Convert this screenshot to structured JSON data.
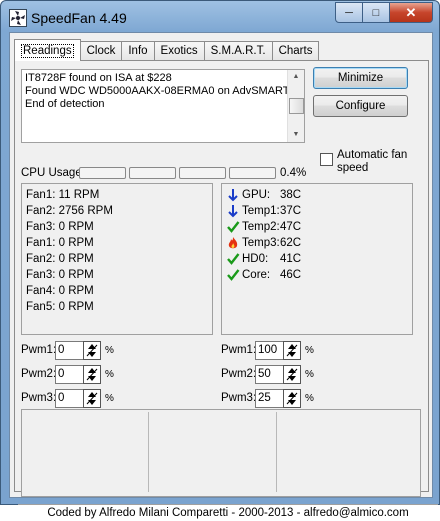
{
  "window": {
    "title": "SpeedFan 4.49",
    "controls": [
      "minimize",
      "maximize",
      "close"
    ]
  },
  "tabs": [
    {
      "label": "Readings",
      "active": true
    },
    {
      "label": "Clock"
    },
    {
      "label": "Info"
    },
    {
      "label": "Exotics"
    },
    {
      "label": "S.M.A.R.T."
    },
    {
      "label": "Charts"
    }
  ],
  "log": {
    "lines": [
      "IT8728F found on ISA at $228",
      "Found WDC WD5000AAKX-08ERMA0 on AdvSMART",
      "End of detection"
    ]
  },
  "buttons": {
    "minimize": "Minimize",
    "configure": "Configure"
  },
  "auto_fan": {
    "label": "Automatic fan speed",
    "checked": false
  },
  "cpu": {
    "label": "CPU Usage",
    "percent_text": "0.4%",
    "bars": [
      0,
      0,
      0,
      0
    ]
  },
  "fans": [
    "Fan1: 11 RPM",
    "Fan2: 2756 RPM",
    "Fan3: 0 RPM",
    "Fan1: 0 RPM",
    "Fan2: 0 RPM",
    "Fan3: 0 RPM",
    "Fan4: 0 RPM",
    "Fan5: 0 RPM"
  ],
  "temps": [
    {
      "name": "GPU:",
      "value": "38C",
      "icon": "arrow-down-icon"
    },
    {
      "name": "Temp1:",
      "value": "37C",
      "icon": "arrow-down-icon"
    },
    {
      "name": "Temp2:",
      "value": "47C",
      "icon": "check-icon"
    },
    {
      "name": "Temp3:",
      "value": "62C",
      "icon": "flame-icon"
    },
    {
      "name": "HD0:",
      "value": "41C",
      "icon": "check-icon"
    },
    {
      "name": "Core:",
      "value": "46C",
      "icon": "check-icon"
    }
  ],
  "pwm_left": [
    {
      "label": "Pwm1:",
      "value": "0",
      "unit": "%"
    },
    {
      "label": "Pwm2:",
      "value": "0",
      "unit": "%"
    },
    {
      "label": "Pwm3:",
      "value": "0",
      "unit": "%"
    }
  ],
  "pwm_right": [
    {
      "label": "Pwm1:",
      "value": "100",
      "unit": "%"
    },
    {
      "label": "Pwm2:",
      "value": "50",
      "unit": "%"
    },
    {
      "label": "Pwm3:",
      "value": "25",
      "unit": "%"
    }
  ],
  "status": "Coded by Alfredo Milani Comparetti - 2000-2013 - alfredo@almico.com",
  "colors": {
    "arrow": "#1a3cc8",
    "check": "#1a9a1a",
    "flame": "#e53010"
  }
}
